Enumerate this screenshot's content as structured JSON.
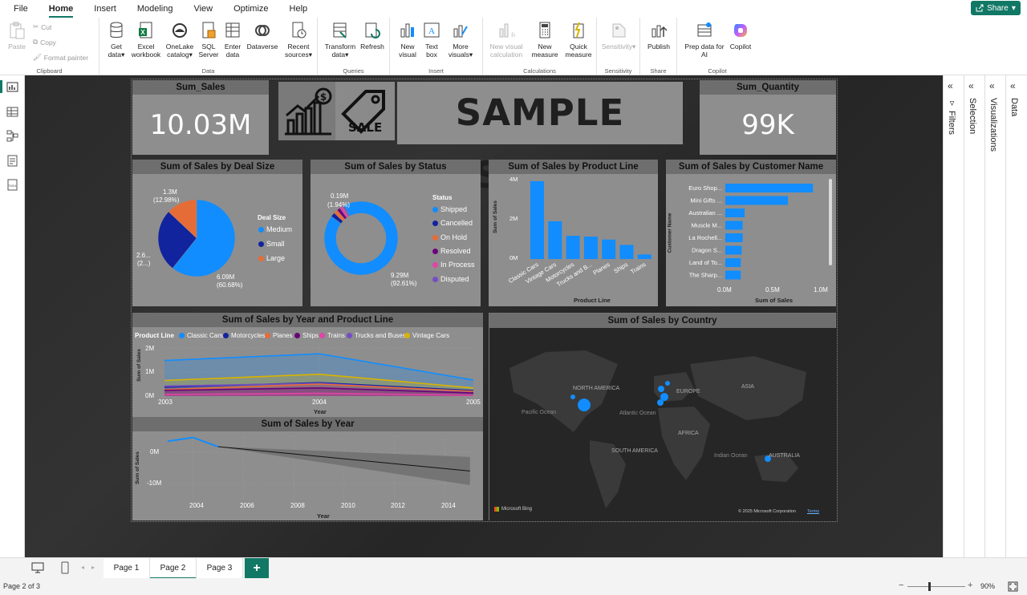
{
  "menu": {
    "items": [
      "File",
      "Home",
      "Insert",
      "Modeling",
      "View",
      "Optimize",
      "Help"
    ],
    "active": "Home",
    "share_label": "Share"
  },
  "ribbon": {
    "clipboard": {
      "label": "Clipboard",
      "paste": "Paste",
      "cut": "Cut",
      "copy": "Copy",
      "format_painter": "Format painter"
    },
    "data": {
      "label": "Data",
      "get_data": [
        "Get",
        "data"
      ],
      "excel": [
        "Excel",
        "workbook"
      ],
      "onelake": [
        "OneLake",
        "catalog"
      ],
      "sql": [
        "SQL",
        "Server"
      ],
      "enter_data": [
        "Enter",
        "data"
      ],
      "dataverse": "Dataverse",
      "recent": [
        "Recent",
        "sources"
      ]
    },
    "queries": {
      "label": "Queries",
      "transform": [
        "Transform",
        "data"
      ],
      "refresh": "Refresh"
    },
    "insert": {
      "label": "Insert",
      "new_visual": [
        "New",
        "visual"
      ],
      "text_box": [
        "Text",
        "box"
      ],
      "more_visuals": [
        "More",
        "visuals"
      ]
    },
    "calculations": {
      "label": "Calculations",
      "new_visual_calc": [
        "New visual",
        "calculation"
      ],
      "new_measure": [
        "New",
        "measure"
      ],
      "quick_measure": [
        "Quick",
        "measure"
      ]
    },
    "sensitivity": {
      "label": "Sensitivity",
      "sensitivity": "Sensitivity"
    },
    "share": {
      "label": "Share",
      "publish": "Publish"
    },
    "copilot": {
      "label": "Copilot",
      "prep_data": [
        "Prep data for",
        "AI"
      ],
      "copilot": "Copilot"
    }
  },
  "right_panes": {
    "filters": "Filters",
    "selection": "Selection",
    "visualizations": "Visualizations",
    "data": "Data"
  },
  "report": {
    "kpi_sales": {
      "title": "Sum_Sales",
      "value": "10.03M"
    },
    "kpi_quantity": {
      "title": "Sum_Quantity",
      "value": "99K"
    },
    "banner": {
      "title": "SAMPLE SALES",
      "sale_tag": "SALE"
    },
    "deal_size": {
      "title": "Sum of Sales by Deal Size",
      "legend_title": "Deal Size",
      "legend": [
        "Medium",
        "Small",
        "Large"
      ],
      "labels": {
        "large": [
          "1.3M",
          "(12.98%)"
        ],
        "small": [
          "2.6...",
          "(2...)"
        ],
        "medium": [
          "6.09M",
          "(60.68%)"
        ]
      }
    },
    "status": {
      "title": "Sum of Sales by Status",
      "legend_title": "Status",
      "legend": [
        "Shipped",
        "Cancelled",
        "On Hold",
        "Resolved",
        "In Process",
        "Disputed"
      ],
      "labels": {
        "small": [
          "0.19M",
          "(1.94%)"
        ],
        "big": [
          "9.29M",
          "(92.61%)"
        ]
      }
    },
    "product_line": {
      "title": "Sum of Sales by Product Line",
      "yticks": [
        "4M",
        "2M",
        "0M"
      ],
      "ylabel": "Sum of Sales",
      "xlabel": "Product Line",
      "categories": [
        "Classic Cars",
        "Vintage Cars",
        "Motorcycles",
        "Trucks and B...",
        "Planes",
        "Ships",
        "Trains"
      ]
    },
    "customer": {
      "title": "Sum of Sales by Customer Name",
      "ylabel": "Customer Name",
      "xlabel": "Sum of Sales",
      "xticks": [
        "0.0M",
        "0.5M",
        "1.0M"
      ],
      "categories": [
        "Euro Shop...",
        "Mini Gifts ...",
        "Australian ...",
        "Muscle M...",
        "La Rochell...",
        "Dragon S...",
        "Land of To...",
        "The Sharp..."
      ]
    },
    "year_product": {
      "title": "Sum of Sales by Year and Product Line",
      "legend_title": "Product Line",
      "legend": [
        "Classic Cars",
        "Motorcycles",
        "Planes",
        "Ships",
        "Trains",
        "Trucks and Buses",
        "Vintage Cars"
      ],
      "yticks": [
        "2M",
        "1M",
        "0M"
      ],
      "xticks": [
        "2003",
        "2004",
        "2005"
      ],
      "ylabel": "Sum of Sales",
      "xlabel": "Year"
    },
    "by_year": {
      "title": "Sum of Sales by Year",
      "yticks": [
        "0M",
        "-10M"
      ],
      "xticks": [
        "2004",
        "2006",
        "2008",
        "2010",
        "2012",
        "2014"
      ],
      "ylabel": "Sum of Sales",
      "xlabel": "Year"
    },
    "map": {
      "title": "Sum of Sales by Country",
      "labels": [
        "NORTH AMERICA",
        "EUROPE",
        "ASIA",
        "Pacific Ocean",
        "Atlantic Ocean",
        "AFRICA",
        "SOUTH AMERICA",
        "Indian Ocean",
        "AUSTRALIA"
      ],
      "brand": "Microsoft Bing",
      "copyright": "© 2025 Microsoft Corporation",
      "terms": "Terms"
    }
  },
  "tabs": [
    "Page 1",
    "Page 2",
    "Page 3"
  ],
  "active_tab": "Page 2",
  "status": {
    "page": "Page 2 of 3",
    "zoom": "90%"
  },
  "colors": {
    "accent": "#117865",
    "blue": "#118dff",
    "navy": "#12239e",
    "orange": "#e66c37",
    "purple": "#6b007b",
    "pink": "#e044a7",
    "violet": "#744ec2",
    "gold": "#d9b300"
  },
  "chart_data": [
    {
      "type": "pie",
      "title": "Sum of Sales by Deal Size",
      "categories": [
        "Medium",
        "Small",
        "Large"
      ],
      "values": [
        6.09,
        2.64,
        1.3
      ],
      "units": "M"
    },
    {
      "type": "pie",
      "title": "Sum of Sales by Status",
      "categories": [
        "Shipped",
        "Cancelled",
        "On Hold",
        "Resolved",
        "In Process",
        "Disputed"
      ],
      "values": [
        9.29,
        0.19,
        0.18,
        0.15,
        0.14,
        0.07
      ],
      "units": "M"
    },
    {
      "type": "bar",
      "title": "Sum of Sales by Product Line",
      "categories": [
        "Classic Cars",
        "Vintage Cars",
        "Motorcycles",
        "Trucks and Buses",
        "Planes",
        "Ships",
        "Trains"
      ],
      "values": [
        3.92,
        1.9,
        1.17,
        1.13,
        0.98,
        0.71,
        0.23
      ],
      "ylim": [
        0,
        4.4
      ]
    },
    {
      "type": "bar",
      "title": "Sum of Sales by Customer Name",
      "categories": [
        "Euro Shop...",
        "Mini Gifts ...",
        "Australian ...",
        "Muscle M...",
        "La Rochell...",
        "Dragon S...",
        "Land of To...",
        "The Sharp..."
      ],
      "values": [
        0.91,
        0.65,
        0.2,
        0.18,
        0.18,
        0.17,
        0.16,
        0.16
      ],
      "xlim": [
        0,
        1.0
      ]
    },
    {
      "type": "line",
      "title": "Sum of Sales by Year and Product Line",
      "x": [
        "2003",
        "2004",
        "2005"
      ],
      "series": [
        {
          "name": "Classic Cars",
          "values": [
            1.48,
            1.76,
            0.67
          ]
        },
        {
          "name": "Vintage Cars",
          "values": [
            0.65,
            0.91,
            0.34
          ]
        },
        {
          "name": "Motorcycles",
          "values": [
            0.37,
            0.56,
            0.23
          ]
        },
        {
          "name": "Trucks and Buses",
          "values": [
            0.42,
            0.53,
            0.18
          ]
        },
        {
          "name": "Planes",
          "values": [
            0.27,
            0.5,
            0.2
          ]
        },
        {
          "name": "Ships",
          "values": [
            0.24,
            0.34,
            0.13
          ]
        },
        {
          "name": "Trains",
          "values": [
            0.07,
            0.12,
            0.04
          ]
        }
      ],
      "ylim": [
        0,
        2
      ]
    },
    {
      "type": "line",
      "title": "Sum of Sales by Year",
      "x": [
        2003,
        2004,
        2005
      ],
      "values": [
        3.52,
        4.72,
        1.79
      ],
      "forecast_to": 2015,
      "ylim": [
        -14,
        4
      ]
    }
  ]
}
